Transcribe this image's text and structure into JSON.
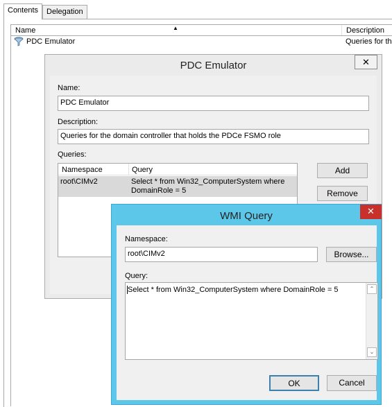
{
  "tabs": [
    {
      "label": "Contents",
      "active": true
    },
    {
      "label": "Delegation",
      "active": false
    }
  ],
  "list": {
    "columns": [
      "Name",
      "Description"
    ],
    "sort_icon": "sort-up-arrow",
    "rows": [
      {
        "icon": "filter-icon",
        "name": "PDC Emulator",
        "description": "Queries for the"
      }
    ]
  },
  "pdc_dialog": {
    "title": "PDC Emulator",
    "close_glyph": "✕",
    "name_label": "Name:",
    "name_value": "PDC Emulator",
    "description_label": "Description:",
    "description_value": "Queries for the domain controller that holds the PDCe FSMO role",
    "queries_label": "Queries:",
    "queries_columns": [
      "Namespace",
      "Query"
    ],
    "queries_rows": [
      {
        "namespace": "root\\CIMv2",
        "query_line1": "Select * from Win32_ComputerSystem where",
        "query_line2": "DomainRole = 5"
      }
    ],
    "add_label": "Add",
    "remove_label": "Remove"
  },
  "wmi_dialog": {
    "title": "WMI Query",
    "close_glyph": "✕",
    "namespace_label": "Namespace:",
    "namespace_value": "root\\CIMv2",
    "browse_label": "Browse...",
    "query_label": "Query:",
    "query_value": "Select * from Win32_ComputerSystem where DomainRole = 5",
    "ok_label": "OK",
    "cancel_label": "Cancel"
  },
  "colors": {
    "wmi_frame": "#5dc7ea",
    "inactive_frame": "#ebebeb",
    "close_red": "#c7302b",
    "selected_row": "#d9d9d9"
  }
}
